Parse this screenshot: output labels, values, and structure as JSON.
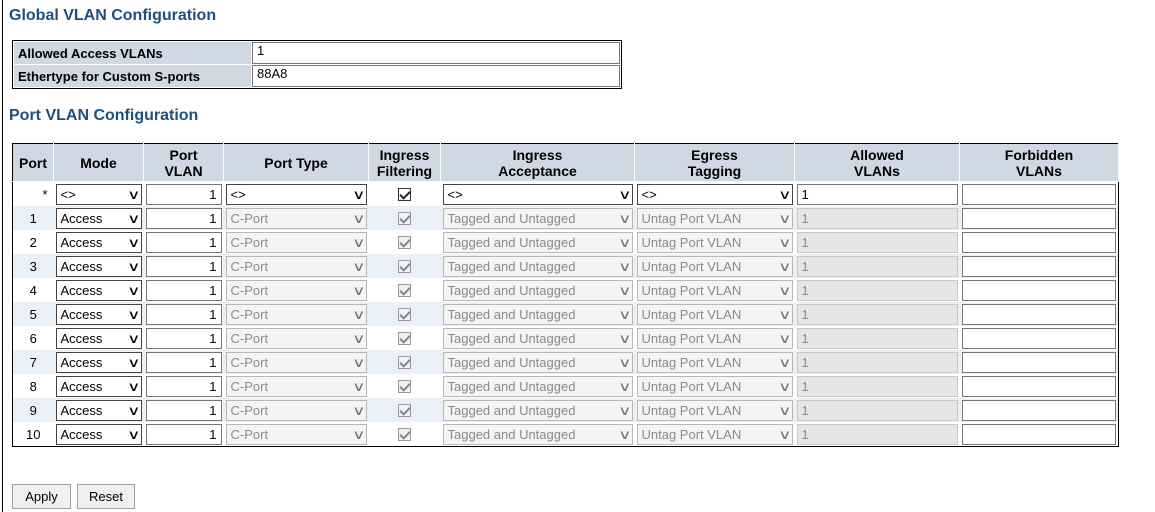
{
  "global": {
    "title": "Global VLAN Configuration",
    "allowed_access_label": "Allowed Access VLANs",
    "allowed_access_value": "1",
    "ethertype_label": "Ethertype for Custom S-ports",
    "ethertype_value": "88A8"
  },
  "port": {
    "title": "Port VLAN Configuration",
    "headers": {
      "port": "Port",
      "mode": "Mode",
      "port_vlan_1": "Port",
      "port_vlan_2": "VLAN",
      "port_type": "Port Type",
      "ingress_filtering_1": "Ingress",
      "ingress_filtering_2": "Filtering",
      "ingress_acceptance_1": "Ingress",
      "ingress_acceptance_2": "Acceptance",
      "egress_tagging_1": "Egress",
      "egress_tagging_2": "Tagging",
      "allowed_vlans_1": "Allowed",
      "allowed_vlans_2": "VLANs",
      "forbidden_vlans_1": "Forbidden",
      "forbidden_vlans_2": "VLANs"
    },
    "wildcard": {
      "port": "*",
      "mode": "<>",
      "port_vlan": "1",
      "port_type": "<>",
      "ingress_filtering": true,
      "ingress_acceptance": "<>",
      "egress_tagging": "<>",
      "allowed_vlans": "1",
      "forbidden_vlans": ""
    },
    "rows": [
      {
        "port": "1",
        "mode": "Access",
        "port_vlan": "1",
        "port_type": "C-Port",
        "ingress_filtering": true,
        "ingress_acceptance": "Tagged and Untagged",
        "egress_tagging": "Untag Port VLAN",
        "allowed_vlans": "1",
        "forbidden_vlans": ""
      },
      {
        "port": "2",
        "mode": "Access",
        "port_vlan": "1",
        "port_type": "C-Port",
        "ingress_filtering": true,
        "ingress_acceptance": "Tagged and Untagged",
        "egress_tagging": "Untag Port VLAN",
        "allowed_vlans": "1",
        "forbidden_vlans": ""
      },
      {
        "port": "3",
        "mode": "Access",
        "port_vlan": "1",
        "port_type": "C-Port",
        "ingress_filtering": true,
        "ingress_acceptance": "Tagged and Untagged",
        "egress_tagging": "Untag Port VLAN",
        "allowed_vlans": "1",
        "forbidden_vlans": ""
      },
      {
        "port": "4",
        "mode": "Access",
        "port_vlan": "1",
        "port_type": "C-Port",
        "ingress_filtering": true,
        "ingress_acceptance": "Tagged and Untagged",
        "egress_tagging": "Untag Port VLAN",
        "allowed_vlans": "1",
        "forbidden_vlans": ""
      },
      {
        "port": "5",
        "mode": "Access",
        "port_vlan": "1",
        "port_type": "C-Port",
        "ingress_filtering": true,
        "ingress_acceptance": "Tagged and Untagged",
        "egress_tagging": "Untag Port VLAN",
        "allowed_vlans": "1",
        "forbidden_vlans": ""
      },
      {
        "port": "6",
        "mode": "Access",
        "port_vlan": "1",
        "port_type": "C-Port",
        "ingress_filtering": true,
        "ingress_acceptance": "Tagged and Untagged",
        "egress_tagging": "Untag Port VLAN",
        "allowed_vlans": "1",
        "forbidden_vlans": ""
      },
      {
        "port": "7",
        "mode": "Access",
        "port_vlan": "1",
        "port_type": "C-Port",
        "ingress_filtering": true,
        "ingress_acceptance": "Tagged and Untagged",
        "egress_tagging": "Untag Port VLAN",
        "allowed_vlans": "1",
        "forbidden_vlans": ""
      },
      {
        "port": "8",
        "mode": "Access",
        "port_vlan": "1",
        "port_type": "C-Port",
        "ingress_filtering": true,
        "ingress_acceptance": "Tagged and Untagged",
        "egress_tagging": "Untag Port VLAN",
        "allowed_vlans": "1",
        "forbidden_vlans": ""
      },
      {
        "port": "9",
        "mode": "Access",
        "port_vlan": "1",
        "port_type": "C-Port",
        "ingress_filtering": true,
        "ingress_acceptance": "Tagged and Untagged",
        "egress_tagging": "Untag Port VLAN",
        "allowed_vlans": "1",
        "forbidden_vlans": ""
      },
      {
        "port": "10",
        "mode": "Access",
        "port_vlan": "1",
        "port_type": "C-Port",
        "ingress_filtering": true,
        "ingress_acceptance": "Tagged and Untagged",
        "egress_tagging": "Untag Port VLAN",
        "allowed_vlans": "1",
        "forbidden_vlans": ""
      }
    ]
  },
  "buttons": {
    "apply": "Apply",
    "reset": "Reset"
  }
}
